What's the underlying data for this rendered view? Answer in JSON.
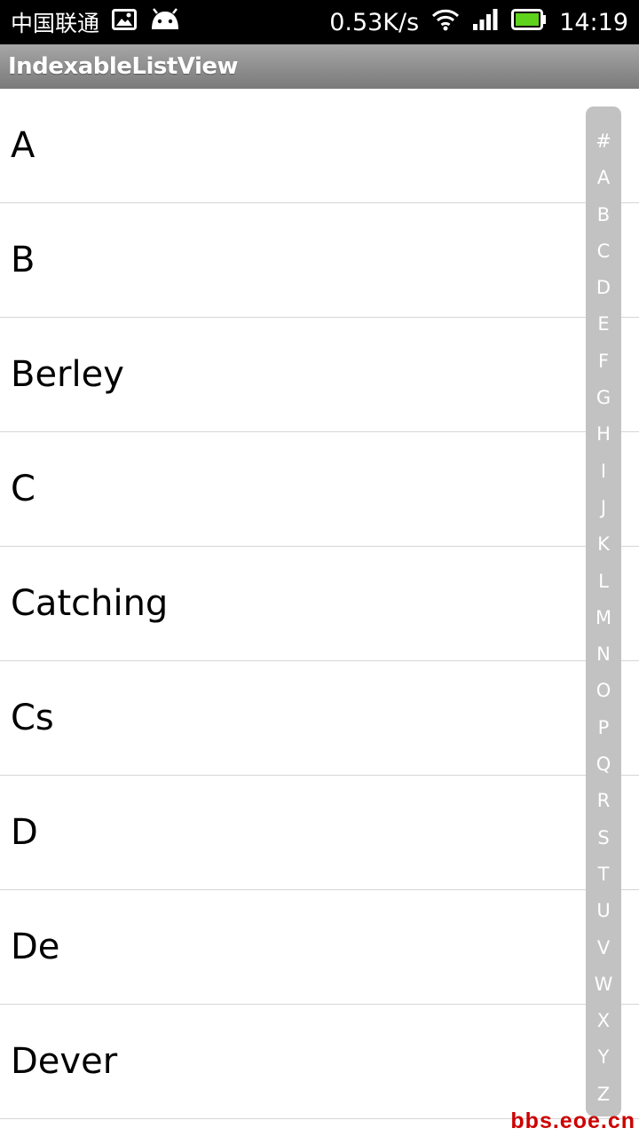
{
  "status_bar": {
    "carrier": "中国联通",
    "network_speed": "0.53K/s",
    "time": "14:19",
    "battery_color": "#5fd21b"
  },
  "app": {
    "title": "IndexableListView"
  },
  "list_items": [
    "A",
    "B",
    "Berley",
    "C",
    "Catching",
    "Cs",
    "D",
    "De",
    "Dever"
  ],
  "index_letters": [
    "#",
    "A",
    "B",
    "C",
    "D",
    "E",
    "F",
    "G",
    "H",
    "I",
    "J",
    "K",
    "L",
    "M",
    "N",
    "O",
    "P",
    "Q",
    "R",
    "S",
    "T",
    "U",
    "V",
    "W",
    "X",
    "Y",
    "Z"
  ],
  "watermark": "bbs.eoe.cn"
}
